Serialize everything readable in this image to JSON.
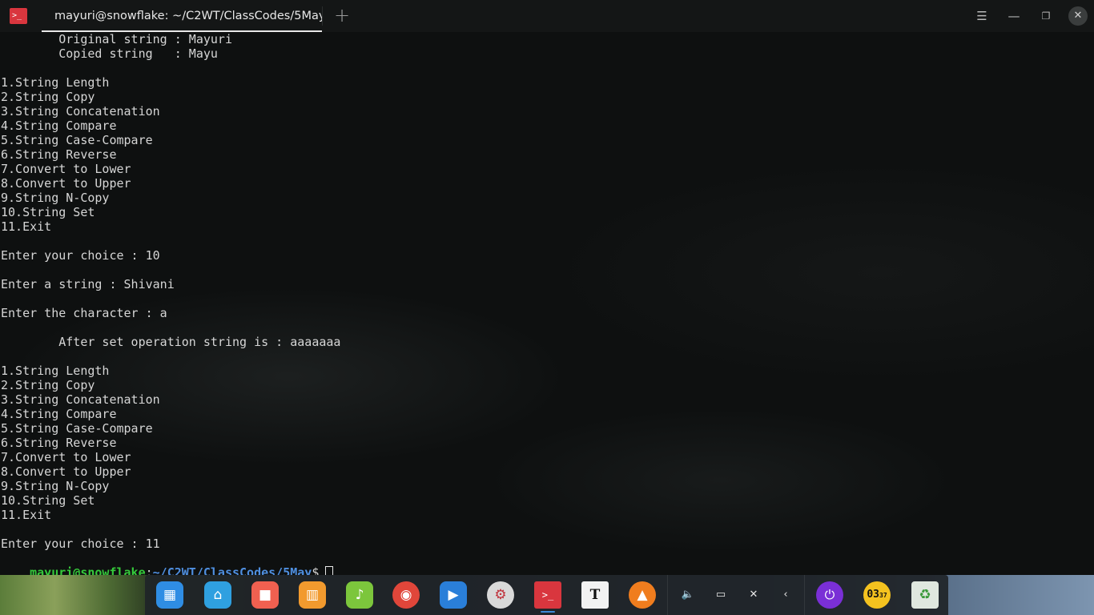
{
  "titlebar": {
    "tab_title": "mayuri@snowflake: ~/C2WT/ClassCodes/5May",
    "new_tab_glyph": "+",
    "menu_glyph": "☰",
    "minimize_glyph": "—",
    "maximize_glyph": "❐",
    "close_glyph": "✕",
    "app_icon": "terminal-icon"
  },
  "terminal": {
    "lines": [
      "        Original string : Mayuri",
      "        Copied string   : Mayu",
      "",
      "1.String Length",
      "2.String Copy",
      "3.String Concatenation",
      "4.String Compare",
      "5.String Case-Compare",
      "6.String Reverse",
      "7.Convert to Lower",
      "8.Convert to Upper",
      "9.String N-Copy",
      "10.String Set",
      "11.Exit",
      "",
      "Enter your choice : 10",
      "",
      "Enter a string : Shivani",
      "",
      "Enter the character : a",
      "",
      "        After set operation string is : aaaaaaa",
      "",
      "1.String Length",
      "2.String Copy",
      "3.String Concatenation",
      "4.String Compare",
      "5.String Case-Compare",
      "6.String Reverse",
      "7.Convert to Lower",
      "8.Convert to Upper",
      "9.String N-Copy",
      "10.String Set",
      "11.Exit",
      "",
      "Enter your choice : 11"
    ],
    "prompt": {
      "user_host": "mayuri@snowflake",
      "colon": ":",
      "path": "~/C2WT/ClassCodes/5May",
      "symbol": "$"
    }
  },
  "dock": {
    "apps": [
      {
        "name": "launcher-icon",
        "glyph": "▦",
        "color": "#2f8de4"
      },
      {
        "name": "file-manager-icon",
        "glyph": "⌂",
        "color": "#2fa0e0"
      },
      {
        "name": "screen-recorder-icon",
        "glyph": "■",
        "color": "#f06050"
      },
      {
        "name": "app-store-icon",
        "glyph": "▥",
        "color": "#f29a2e"
      },
      {
        "name": "music-player-icon",
        "glyph": "♪",
        "color": "#7cc63c"
      },
      {
        "name": "chrome-icon",
        "glyph": "◉",
        "color": "#e0463a"
      },
      {
        "name": "video-player-icon",
        "glyph": "▶",
        "color": "#2a7fd9"
      },
      {
        "name": "settings-icon",
        "glyph": "⚙",
        "color": "#d9d9d9"
      },
      {
        "name": "terminal-app-icon",
        "glyph": ">_",
        "color": "#d9363e"
      },
      {
        "name": "text-editor-icon",
        "glyph": "T",
        "color": "#f2f2f2"
      },
      {
        "name": "vlc-icon",
        "glyph": "▲",
        "color": "#f07d1e"
      }
    ],
    "tray": [
      {
        "name": "volume-icon",
        "glyph": "🔈"
      },
      {
        "name": "battery-icon",
        "glyph": "▭"
      },
      {
        "name": "network-off-icon",
        "glyph": "✕"
      },
      {
        "name": "tray-expand-icon",
        "glyph": "‹"
      }
    ],
    "power_glyph": "⏻",
    "clock_text": "03",
    "clock_minutes": "37",
    "trash_glyph": "♻"
  }
}
